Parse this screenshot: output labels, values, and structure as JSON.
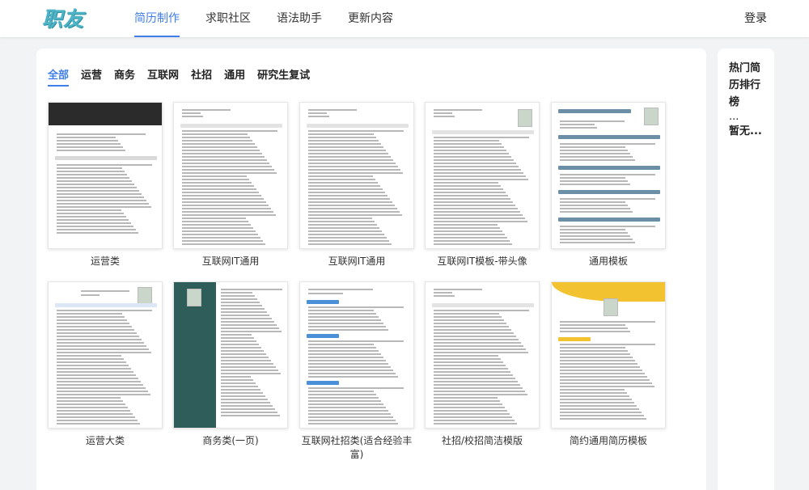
{
  "header": {
    "logo_text": "职友",
    "nav": [
      "简历制作",
      "求职社区",
      "语法助手",
      "更新内容"
    ],
    "active_nav": 0,
    "login": "登录"
  },
  "categories": {
    "items": [
      "全部",
      "运营",
      "商务",
      "互联网",
      "社招",
      "通用",
      "研究生复试"
    ],
    "active": 0
  },
  "templates": [
    {
      "label": "运营类",
      "style": "dark-header"
    },
    {
      "label": "互联网IT通用",
      "style": "plain"
    },
    {
      "label": "互联网IT通用",
      "style": "plain"
    },
    {
      "label": "互联网IT模板-带头像",
      "style": "plain-photo"
    },
    {
      "label": "通用模板",
      "style": "teal-banner"
    },
    {
      "label": "运营大类",
      "style": "blue-lines"
    },
    {
      "label": "商务类(一页)",
      "style": "green-sidebar"
    },
    {
      "label": "互联网社招类(适合经验丰富)",
      "style": "blue-sections"
    },
    {
      "label": "社招/校招简洁模版",
      "style": "plain"
    },
    {
      "label": "简约通用简历模板",
      "style": "yellow-wave"
    }
  ],
  "sidebar": {
    "title": "热门简历排行榜",
    "dots": "...",
    "empty": "暂无..."
  },
  "colors": {
    "accent": "#3f7ee8",
    "logo": "#4fb3c6",
    "page_bg": "#f2f3f5"
  }
}
